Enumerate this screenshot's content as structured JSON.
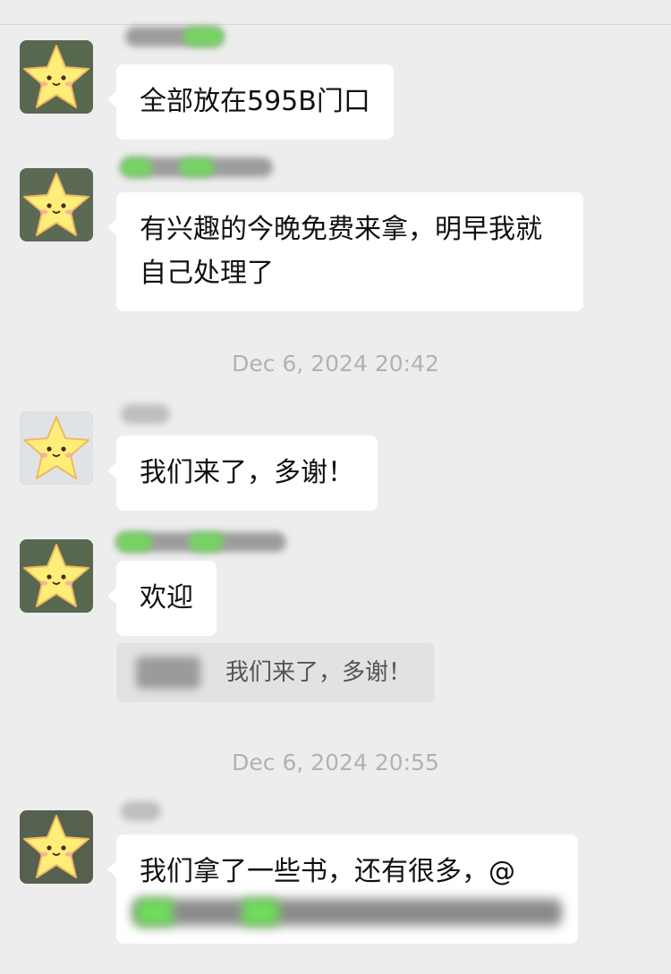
{
  "messages": [
    {
      "text": "全部放在595B门口"
    },
    {
      "text": "有兴趣的今晚免费来拿，明早我就自己处理了"
    },
    {
      "text": "我们来了，多谢！"
    },
    {
      "text": "欢迎",
      "quote": {
        "text": "我们来了，多谢！"
      }
    },
    {
      "text": "我们拿了一些书，还有很多，@"
    }
  ],
  "timestamps": [
    "Dec 6, 2024 20:42",
    "Dec 6, 2024 20:55"
  ],
  "theme": {
    "background": "#ededed",
    "bubble": "#ffffff",
    "quote_bg": "#e2e2e2",
    "timestamp_color": "#b2b2b2",
    "avatar_star": "#fdee7a",
    "redaction_green": "#6fdc5a",
    "redaction_gray": "#8e8e8e"
  }
}
